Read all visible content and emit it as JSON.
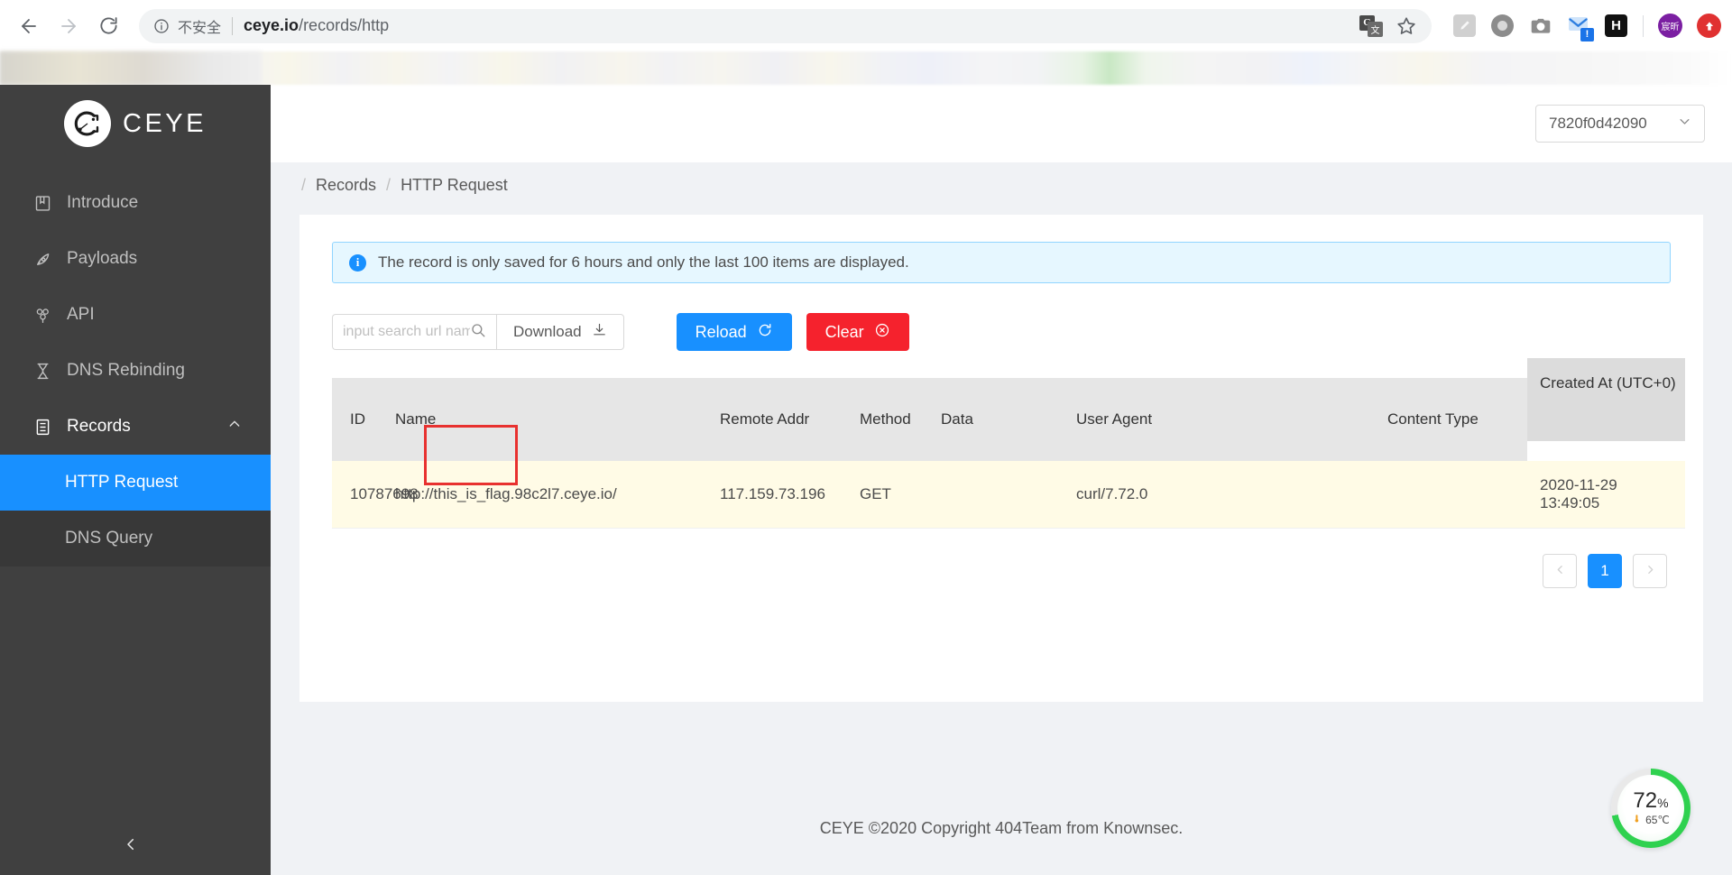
{
  "browser": {
    "back_icon": "back-arrow-icon",
    "forward_icon": "forward-arrow-icon",
    "reload_icon": "reload-icon",
    "security_label": "不安全",
    "url_host": "ceye.io",
    "url_path": "/records/http",
    "translate_icon": "translate-icon",
    "translate_glyph": "G",
    "bookmark_icon": "star-icon",
    "extensions": [
      {
        "name": "ext-pencil-icon"
      },
      {
        "name": "ext-circle-icon"
      },
      {
        "name": "ext-camera-icon"
      },
      {
        "name": "ext-mail-icon",
        "badge": "!"
      },
      {
        "name": "ext-hypothesis-icon",
        "label": "H"
      }
    ],
    "profile_avatar_label": "宸昕",
    "profile_avatar_color": "#7b1fa2",
    "action_avatar_color": "#e03131"
  },
  "sidebar": {
    "brand_name": "CEYE",
    "brand_logo_icon": "ceye-logo-icon",
    "items": [
      {
        "label": "Introduce",
        "icon": "book-icon"
      },
      {
        "label": "Payloads",
        "icon": "rocket-icon"
      },
      {
        "label": "API",
        "icon": "molecule-icon"
      },
      {
        "label": "DNS Rebinding",
        "icon": "hourglass-icon"
      },
      {
        "label": "Records",
        "icon": "database-icon",
        "expanded": true
      }
    ],
    "sub_items": [
      {
        "label": "HTTP Request",
        "active": true
      },
      {
        "label": "DNS Query",
        "active": false
      }
    ],
    "collapse_icon": "chevron-left-icon",
    "active_color": "#1890ff"
  },
  "topbar": {
    "account_id": "7820f0d42090",
    "account_caret_icon": "chevron-down-icon"
  },
  "breadcrumb": {
    "separator": "/",
    "items": [
      "Records",
      "HTTP Request"
    ]
  },
  "alert": {
    "icon": "info-circle-icon",
    "icon_glyph": "i",
    "text": "The record is only saved for 6 hours and only the last 100 items are displayed.",
    "accent_color": "#1890ff"
  },
  "toolbar": {
    "search_placeholder": "input search url name",
    "search_value": "",
    "search_icon": "search-icon",
    "download_label": "Download",
    "download_icon": "download-icon",
    "reload_label": "Reload",
    "reload_icon": "refresh-icon",
    "reload_color": "#1890ff",
    "clear_label": "Clear",
    "clear_icon": "close-circle-icon",
    "clear_color": "#f5222d"
  },
  "table": {
    "columns": [
      "ID",
      "Name",
      "Remote Addr",
      "Method",
      "Data",
      "User Agent",
      "Content Type",
      "Created At (UTC+0)"
    ],
    "rows": [
      {
        "id": "10787698",
        "name": "http://this_is_flag.98c2l7.ceye.io/",
        "remote_addr": "117.159.73.196",
        "method": "GET",
        "data": "",
        "user_agent": "curl/7.72.0",
        "content_type": "",
        "created_at": "2020-11-29 13:49:05"
      }
    ],
    "row_highlight_color": "#fffbe6"
  },
  "annotation": {
    "box_color": "#e8312f",
    "target": "name-cell-highlight"
  },
  "pagination": {
    "prev_icon": "chevron-left-icon",
    "next_icon": "chevron-right-icon",
    "pages": [
      "1"
    ],
    "current_page": "1"
  },
  "footer": {
    "text": "CEYE ©2020 Copyright 404Team from Knownsec."
  },
  "gauge": {
    "percent": "72",
    "percent_unit": "%",
    "temperature": "65℃",
    "thermometer_icon": "thermometer-icon",
    "ring_color": "#2fd14f",
    "ring_track_color": "#e9e9e9"
  }
}
